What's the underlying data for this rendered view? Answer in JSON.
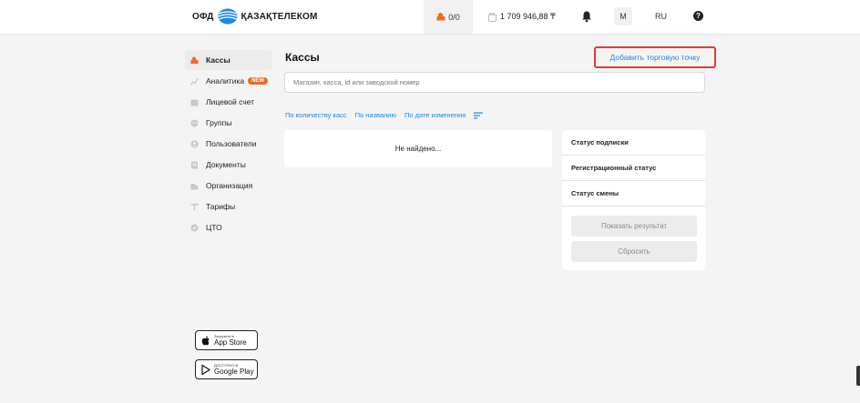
{
  "header": {
    "logo_left": "ОФД",
    "logo_right": "ҚАЗАҚТЕЛЕКОМ",
    "cashbox_counter": "0/0",
    "balance": "1 709 946,88 ₸",
    "avatar_letter": "M",
    "language": "RU",
    "help": "?"
  },
  "sidebar": {
    "items": [
      {
        "label": "Кассы"
      },
      {
        "label": "Аналитика",
        "badge": "NEW"
      },
      {
        "label": "Лицевой счет"
      },
      {
        "label": "Группы"
      },
      {
        "label": "Пользователи"
      },
      {
        "label": "Документы"
      },
      {
        "label": "Организация"
      },
      {
        "label": "Тарифы"
      },
      {
        "label": "ЦТО"
      }
    ]
  },
  "stores": {
    "appstore_small": "Загрузите в",
    "appstore_big": "App Store",
    "googleplay_small": "ДОСТУПНО В",
    "googleplay_big": "Google Play"
  },
  "main": {
    "title": "Кассы",
    "add_button": "Добавить торговую точку",
    "search_placeholder": "Магазин, касса, id или заводской номер",
    "sort_options": [
      "По количеству касс",
      "По названию",
      "По дате изменения"
    ],
    "empty_text": "Не найдено..."
  },
  "filters": {
    "rows": [
      "Статус подписки",
      "Регистрационный статус",
      "Статус смены"
    ],
    "show_button": "Показать результат",
    "reset_button": "Сбросить"
  },
  "colors": {
    "accent_blue": "#1e88e5",
    "accent_orange": "#f06a24",
    "highlight_red": "#e53935"
  }
}
